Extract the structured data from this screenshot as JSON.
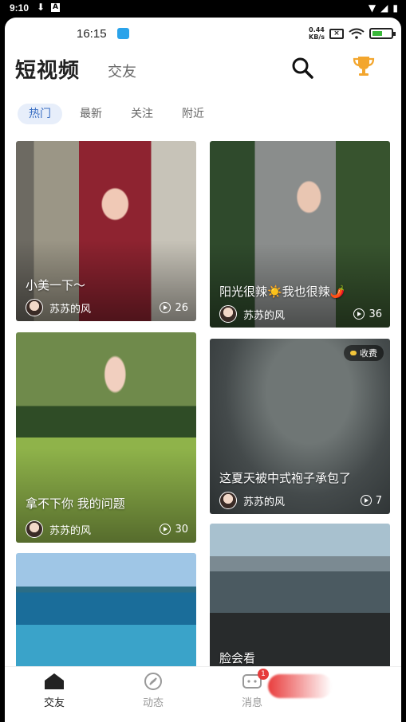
{
  "os_status": {
    "time": "9:10"
  },
  "inner_status": {
    "time": "16:15",
    "net_speed": "0.44",
    "net_unit": "KB/s"
  },
  "header": {
    "title": "短视频",
    "subtitle": "交友"
  },
  "tabs": [
    {
      "label": "热门",
      "active": true
    },
    {
      "label": "最新",
      "active": false
    },
    {
      "label": "关注",
      "active": false
    },
    {
      "label": "附近",
      "active": false
    }
  ],
  "cards": [
    {
      "caption": "小美一下～",
      "author": "苏苏的风",
      "plays": "26"
    },
    {
      "caption": "阳光很辣☀️我也很辣🌶️",
      "author": "苏苏的风",
      "plays": "36"
    },
    {
      "caption": "拿不下你 我的问题",
      "author": "苏苏的风",
      "plays": "30"
    },
    {
      "caption": "这夏天被中式袍子承包了",
      "author": "苏苏的风",
      "plays": "7",
      "badge": "收费"
    },
    {
      "caption": ""
    },
    {
      "caption": "脸会看"
    }
  ],
  "bottom_nav": [
    {
      "label": "交友",
      "active": true,
      "icon": "home-icon"
    },
    {
      "label": "动态",
      "active": false,
      "icon": "compass-icon"
    },
    {
      "label": "消息",
      "active": false,
      "icon": "message-icon",
      "badge": "1"
    }
  ]
}
